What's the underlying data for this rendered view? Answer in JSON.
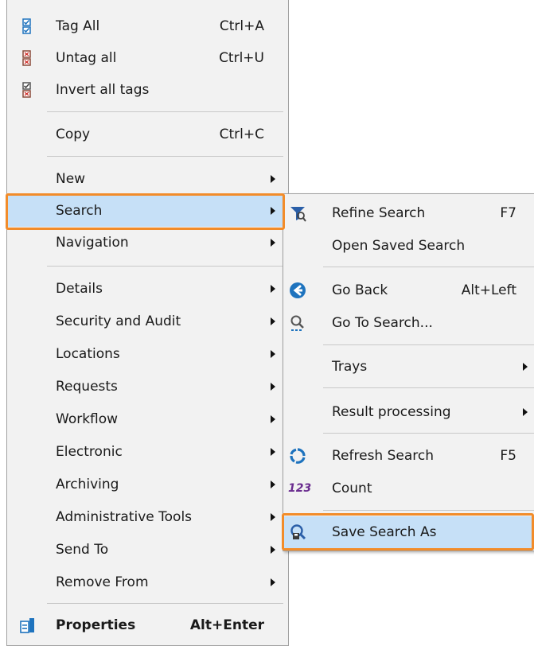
{
  "main_menu": {
    "tag_all": {
      "label": "Tag All",
      "shortcut": "Ctrl+A"
    },
    "untag_all": {
      "label": "Untag all",
      "shortcut": "Ctrl+U"
    },
    "invert_all_tags": {
      "label": "Invert all tags"
    },
    "copy": {
      "label": "Copy",
      "shortcut": "Ctrl+C"
    },
    "new": {
      "label": "New"
    },
    "search": {
      "label": "Search"
    },
    "navigation": {
      "label": "Navigation"
    },
    "details": {
      "label": "Details"
    },
    "security_and_audit": {
      "label": "Security and Audit"
    },
    "locations": {
      "label": "Locations"
    },
    "requests": {
      "label": "Requests"
    },
    "workflow": {
      "label": "Workflow"
    },
    "electronic": {
      "label": "Electronic"
    },
    "archiving": {
      "label": "Archiving"
    },
    "administrative_tools": {
      "label": "Administrative Tools"
    },
    "send_to": {
      "label": "Send To"
    },
    "remove_from": {
      "label": "Remove From"
    },
    "properties": {
      "label": "Properties",
      "shortcut": "Alt+Enter"
    }
  },
  "search_submenu": {
    "refine_search": {
      "label": "Refine Search",
      "shortcut": "F7"
    },
    "open_saved_search": {
      "label": "Open Saved Search"
    },
    "go_back": {
      "label": "Go Back",
      "shortcut": "Alt+Left"
    },
    "go_to_search": {
      "label": "Go To Search..."
    },
    "trays": {
      "label": "Trays"
    },
    "result_processing": {
      "label": "Result processing"
    },
    "refresh_search": {
      "label": "Refresh Search",
      "shortcut": "F5"
    },
    "count": {
      "label": "Count",
      "icon_text": "123"
    },
    "save_search_as": {
      "label": "Save Search As"
    }
  },
  "colors": {
    "highlight": "#c6e0f7",
    "focus_outline": "#f28c2a",
    "icon_blue": "#1e73be",
    "icon_purple": "#6a2c8f"
  },
  "icons": {
    "tag_all": "checkbox-tagged-icon",
    "untag_all": "checkbox-untagged-icon",
    "invert_all_tags": "invert-tags-icon",
    "refine_search": "refine-search-icon",
    "go_back": "back-arrow-icon",
    "go_to_search": "go-to-search-icon",
    "refresh_search": "refresh-icon",
    "count": "count-icon",
    "save_search_as": "save-search-icon",
    "properties": "properties-icon"
  }
}
